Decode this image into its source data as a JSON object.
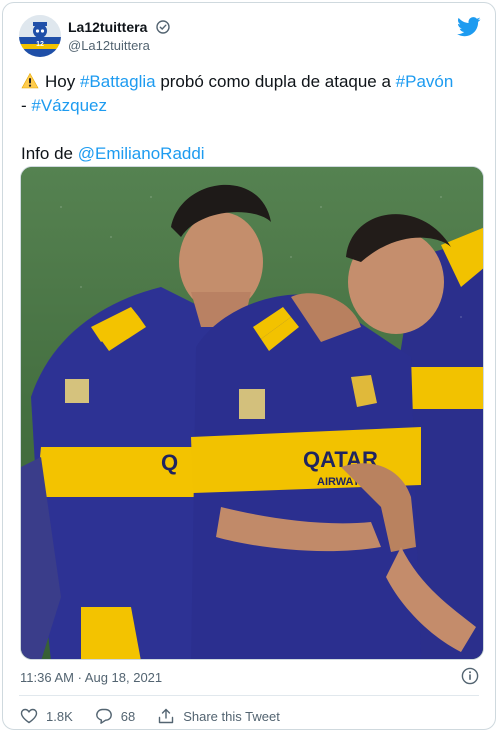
{
  "author": {
    "display_name": "La12tuittera",
    "handle": "@La12tuittera",
    "avatar_icon": "la12-logo-avatar",
    "verified_icon": "verified-badge-icon"
  },
  "brand_icon": "twitter-bird-icon",
  "tweet": {
    "line1_prefix": "Hoy ",
    "mention_battaglia": "#Battaglia",
    "line1_middle": " probó como dupla de ataque a ",
    "mention_pavon": "#Pavón",
    "line2_prefix": "- ",
    "mention_vazquez": "#Vázquez",
    "info_prefix": "Info de ",
    "mention_raddi": "@EmilianoRaddi",
    "warning_icon": "warning-sign-icon"
  },
  "media": {
    "subject": "photo-two-players-boca-juniors-kit"
  },
  "meta": {
    "timestamp": "11:36 AM · Aug 18, 2021",
    "info_icon": "info-icon"
  },
  "actions": {
    "likes": "1.8K",
    "replies": "68",
    "share_label": "Share this Tweet"
  },
  "colors": {
    "link": "#1d9bf0",
    "text": "#0f1419",
    "muted": "#536471",
    "border": "#cfd9de",
    "boca_blue": "#2a2f8f",
    "boca_gold": "#f2c200"
  }
}
